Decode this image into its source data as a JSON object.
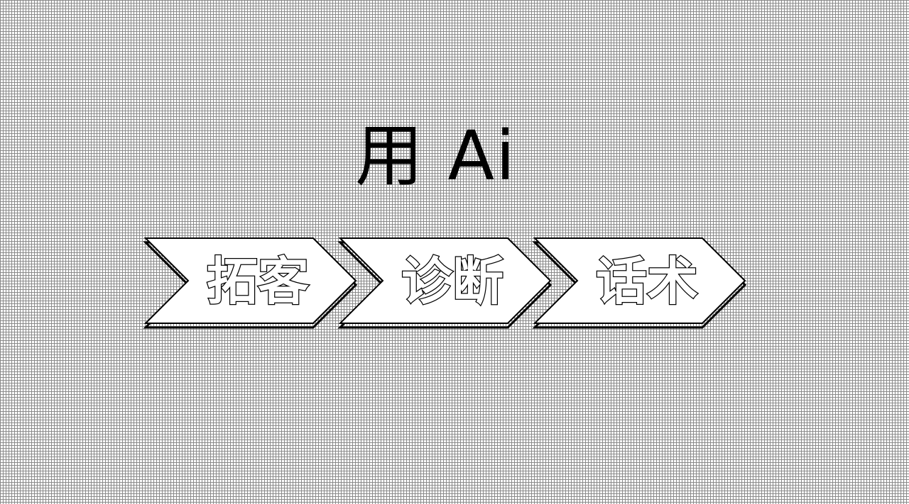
{
  "title": "用 Ai",
  "steps": [
    {
      "label": "拓客"
    },
    {
      "label": "诊断"
    },
    {
      "label": "话术"
    }
  ],
  "colors": {
    "background": "#ffffff",
    "grid": "#8a8a8a",
    "stroke": "#000000",
    "fill": "#ffffff"
  },
  "grid": "dotted"
}
